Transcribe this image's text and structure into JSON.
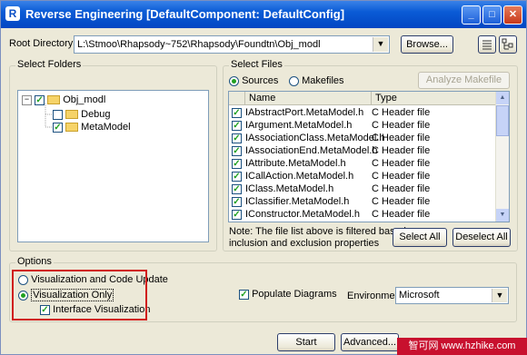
{
  "window": {
    "title": "Reverse Engineering [DefaultComponent: DefaultConfig]",
    "app_icon_letter": "R",
    "minimize_glyph": "_",
    "maximize_glyph": "□",
    "close_glyph": "✕"
  },
  "root_directory": {
    "label": "Root Directory:",
    "value": "L:\\Stmoo\\Rhapsody~752\\Rhapsody\\Foundtn\\Obj_modl",
    "browse_label": "Browse..."
  },
  "select_folders": {
    "title": "Select Folders",
    "tree": [
      {
        "label": "Obj_modl",
        "checked": true,
        "level": 0
      },
      {
        "label": "Debug",
        "checked": false,
        "level": 1
      },
      {
        "label": "MetaModel",
        "checked": true,
        "level": 1
      }
    ]
  },
  "select_files": {
    "title": "Select Files",
    "sources_label": "Sources",
    "makefiles_label": "Makefiles",
    "analyze_label": "Analyze Makefile",
    "columns": {
      "name": "Name",
      "type": "Type"
    },
    "files": [
      {
        "name": "IAbstractPort.MetaModel.h",
        "type": "C Header file"
      },
      {
        "name": "IArgument.MetaModel.h",
        "type": "C Header file"
      },
      {
        "name": "IAssociationClass.MetaModel.h",
        "type": "C Header file"
      },
      {
        "name": "IAssociationEnd.MetaModel.h",
        "type": "C Header file"
      },
      {
        "name": "IAttribute.MetaModel.h",
        "type": "C Header file"
      },
      {
        "name": "ICallAction.MetaModel.h",
        "type": "C Header file"
      },
      {
        "name": "IClass.MetaModel.h",
        "type": "C Header file"
      },
      {
        "name": "IClassifier.MetaModel.h",
        "type": "C Header file"
      },
      {
        "name": "IConstructor.MetaModel.h",
        "type": "C Header file"
      }
    ],
    "note_line1": "Note: The file list above is filtered based on",
    "note_line2": "inclusion and exclusion properties",
    "select_all_label": "Select All",
    "deselect_all_label": "Deselect All"
  },
  "options": {
    "title": "Options",
    "viz_code_label": "Visualization and Code Update",
    "viz_only_label": "Visualization Only",
    "interface_viz_label": "Interface Visualization",
    "populate_label": "Populate Diagrams",
    "environment_label": "Environment",
    "environment_value": "Microsoft"
  },
  "footer": {
    "start_label": "Start",
    "advanced_label": "Advanced..."
  },
  "watermark": "智可网 www.hzhike.com",
  "colors": {
    "highlight": "#d01a1a",
    "titlebar": "#0a5bd6"
  }
}
